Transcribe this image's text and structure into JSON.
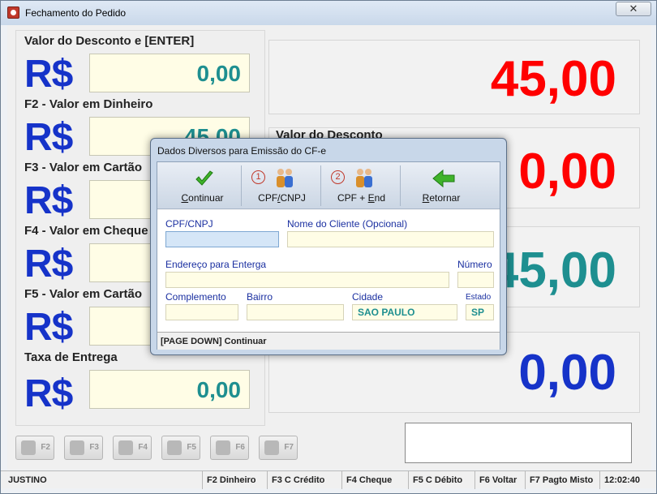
{
  "window": {
    "title": "Fechamento do Pedido",
    "close_glyph": "✕"
  },
  "left": {
    "currency": "R$",
    "fields": [
      {
        "label": "Valor do Desconto e [ENTER]",
        "value": "0,00"
      },
      {
        "label": "F2 - Valor em Dinheiro",
        "value": "45,00"
      },
      {
        "label": "F3 - Valor em Cartão",
        "value": ""
      },
      {
        "label": "F4 - Valor em Cheque",
        "value": ""
      },
      {
        "label": "F5 - Valor em Cartão",
        "value": ""
      },
      {
        "label": "Taxa de Entrega",
        "value": "0,00"
      }
    ]
  },
  "right": {
    "total": {
      "value": "45,00",
      "color": "#ff0000"
    },
    "desconto": {
      "label": "Valor do Desconto",
      "value": "0,00",
      "color": "#ff0000"
    },
    "third": {
      "value": "45,00",
      "color": "#1e8f90"
    },
    "fourth": {
      "value": "0,00",
      "color": "#1633c9"
    }
  },
  "fkeys": [
    "F2",
    "F3",
    "F4",
    "F5",
    "F6",
    "F7"
  ],
  "statusbar": {
    "user": "JUSTINO",
    "f2": "F2 Dinheiro",
    "f3": "F3 C Crédito",
    "f4": "F4 Cheque",
    "f5": "F5 C Débito",
    "f6": "F6 Voltar",
    "f7": "F7 Pagto Misto",
    "time": "12:02:40"
  },
  "dialog": {
    "title": "Dados Diversos para Emissão do CF-e",
    "toolbar": {
      "continuar": {
        "pre": "",
        "key": "C",
        "post": "ontinuar"
      },
      "cpf": {
        "num": "1",
        "pre": "CPF",
        "key": "/",
        "post": "CNPJ"
      },
      "cpf_end": {
        "num": "2",
        "pre": "CPF + ",
        "key": "E",
        "post": "nd"
      },
      "retornar": {
        "pre": "",
        "key": "R",
        "post": "etornar"
      }
    },
    "form": {
      "cpf_label": "CPF/CNPJ",
      "cpf_value": "",
      "nome_label": "Nome do Cliente (Opcional)",
      "nome_value": "",
      "endereco_label": "Endereço para Enterga",
      "endereco_value": "",
      "numero_label": "Número",
      "numero_value": "",
      "complemento_label": "Complemento",
      "complemento_value": "",
      "bairro_label": "Bairro",
      "bairro_value": "",
      "cidade_label": "Cidade",
      "cidade_value": "SAO PAULO",
      "estado_label": "Estado",
      "estado_value": "SP"
    },
    "status": "[PAGE DOWN] Continuar"
  }
}
